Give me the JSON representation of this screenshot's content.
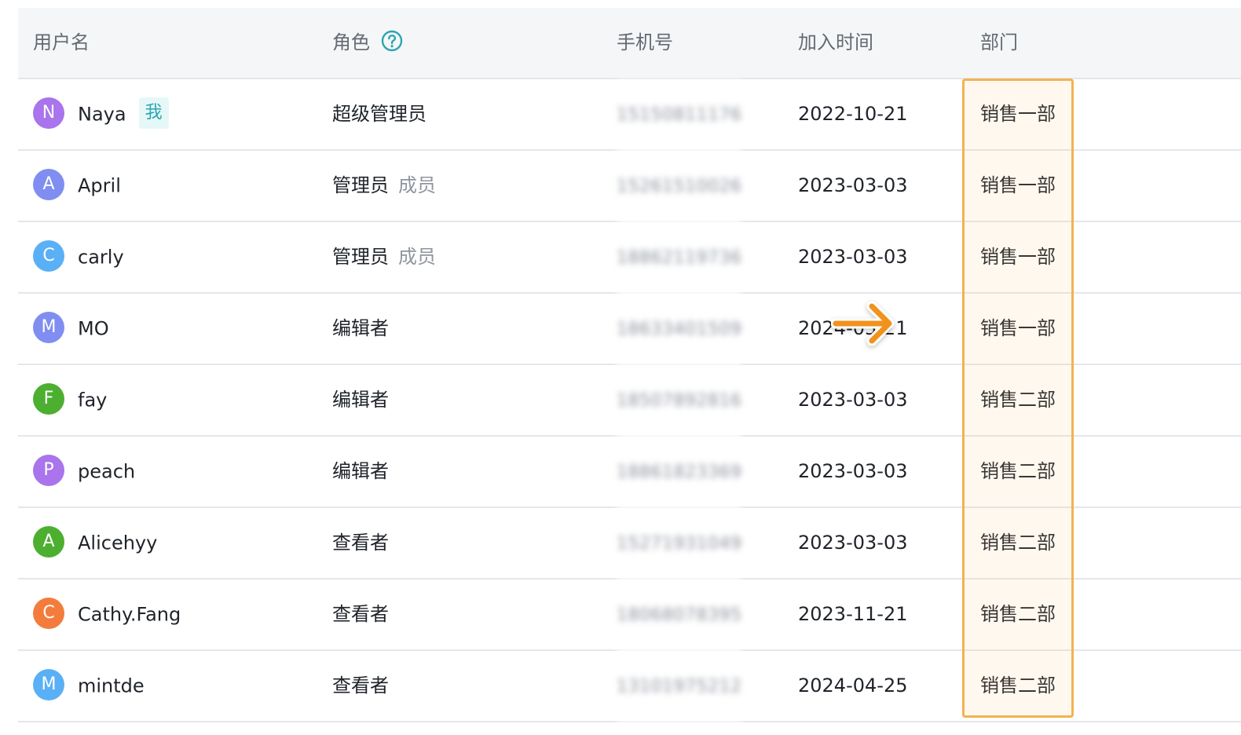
{
  "header": {
    "username": "用户名",
    "role": "角色",
    "phone": "手机号",
    "join_time": "加入时间",
    "department": "部门"
  },
  "colors": {
    "highlight": "#f2b250",
    "arrow": "#f0921e",
    "me_badge": "#2ba6b1",
    "help_icon": "#2ba6b1"
  },
  "rows": [
    {
      "avatar": "N",
      "avatar_color": "#a974ec",
      "name": "Naya",
      "badge": "我",
      "role": "超级管理员",
      "role_sub": "",
      "phone": "15150811176",
      "date": "2022-10-21",
      "dept": "销售一部"
    },
    {
      "avatar": "A",
      "avatar_color": "#7f8ef0",
      "name": "April",
      "badge": "",
      "role": "管理员",
      "role_sub": "成员",
      "phone": "15261510026",
      "date": "2023-03-03",
      "dept": "销售一部"
    },
    {
      "avatar": "C",
      "avatar_color": "#5ab0f6",
      "name": "carly",
      "badge": "",
      "role": "管理员",
      "role_sub": "成员",
      "phone": "18862119736",
      "date": "2023-03-03",
      "dept": "销售一部"
    },
    {
      "avatar": "M",
      "avatar_color": "#7f8ef0",
      "name": "MO",
      "badge": "",
      "role": "编辑者",
      "role_sub": "",
      "phone": "18633401509",
      "date": "2024-05-21",
      "dept": "销售一部"
    },
    {
      "avatar": "F",
      "avatar_color": "#4caf30",
      "name": "fay",
      "badge": "",
      "role": "编辑者",
      "role_sub": "",
      "phone": "18507892816",
      "date": "2023-03-03",
      "dept": "销售二部"
    },
    {
      "avatar": "P",
      "avatar_color": "#a974ec",
      "name": "peach",
      "badge": "",
      "role": "编辑者",
      "role_sub": "",
      "phone": "18861823369",
      "date": "2023-03-03",
      "dept": "销售二部"
    },
    {
      "avatar": "A",
      "avatar_color": "#4caf30",
      "name": "Alicehyy",
      "badge": "",
      "role": "查看者",
      "role_sub": "",
      "phone": "15271931049",
      "date": "2023-03-03",
      "dept": "销售二部"
    },
    {
      "avatar": "C",
      "avatar_color": "#f37c3d",
      "name": "Cathy.Fang",
      "badge": "",
      "role": "查看者",
      "role_sub": "",
      "phone": "18068078395",
      "date": "2023-11-21",
      "dept": "销售二部"
    },
    {
      "avatar": "M",
      "avatar_color": "#5ab0f6",
      "name": "mintde",
      "badge": "",
      "role": "查看者",
      "role_sub": "",
      "phone": "13101975212",
      "date": "2024-04-25",
      "dept": "销售二部"
    }
  ]
}
